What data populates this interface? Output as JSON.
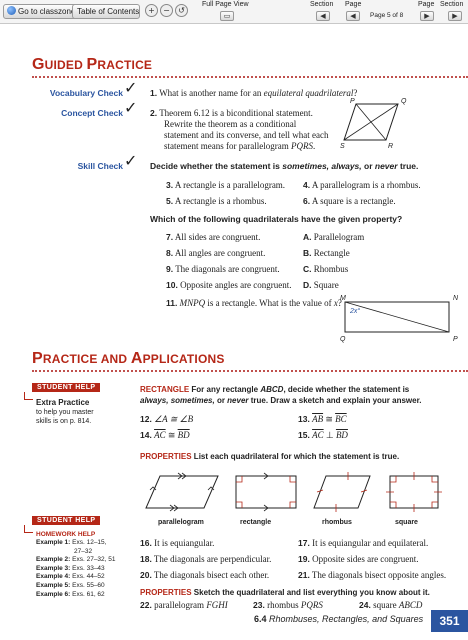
{
  "toolbar": {
    "go_label": "Go to classzone.com",
    "toc_label": "Table of Contents",
    "fullpage_label": "Full Page View",
    "section_label": "Section",
    "page_label": "Page",
    "page_indicator": "Page 5 of 8",
    "page_label2": "Page",
    "section_label2": "Section"
  },
  "guided": {
    "title_first": "G",
    "title_rest": "UIDED ",
    "title_first2": "P",
    "title_rest2": "RACTICE",
    "vocab_label": "Vocabulary Check",
    "concept_label": "Concept Check",
    "skill_label": "Skill Check",
    "check_mark": "✓",
    "q1_num": "1.",
    "q1_text": "What is another name for an ",
    "q1_em": "equilateral quadrilateral",
    "q1_end": "?",
    "q2_num": "2.",
    "q2_l1": "Theorem 6.12 is a biconditional statement.",
    "q2_l2": "Rewrite the theorem as a conditional",
    "q2_l3": "statement and its converse, and tell what each",
    "q2_l4": "statement means for parallelogram ",
    "q2_em": "PQRS",
    "q2_end": ".",
    "fig_P": "P",
    "fig_Q": "Q",
    "fig_S": "S",
    "fig_R": "R",
    "skill_instr_a": "Decide whether the statement is ",
    "skill_instr_b": "sometimes, always,",
    "skill_instr_c": " or ",
    "skill_instr_d": "never",
    "skill_instr_e": " true.",
    "q3_num": "3.",
    "q3": "A rectangle is a parallelogram.",
    "q4_num": "4.",
    "q4": "A parallelogram is a rhombus.",
    "q5_num": "5.",
    "q5": "A rectangle is a rhombus.",
    "q6_num": "6.",
    "q6": "A square is a rectangle.",
    "which": "Which of the following quadrilaterals have the given property?",
    "q7_num": "7.",
    "q7": "All sides are congruent.",
    "q8_num": "8.",
    "q8": "All angles are congruent.",
    "q9_num": "9.",
    "q9": "The diagonals are congruent.",
    "q10_num": "10.",
    "q10": "Opposite angles are congruent.",
    "optA_l": "A.",
    "optA": "Parallelogram",
    "optB_l": "B.",
    "optB": "Rectangle",
    "optC_l": "C.",
    "optC": "Rhombus",
    "optD_l": "D.",
    "optD": "Square",
    "q11_num": "11.",
    "q11_a": "MNPQ",
    "q11_b": " is a rectangle. What is the value of ",
    "q11_c": "x",
    "q11_d": "?",
    "fig_M": "M",
    "fig_N": "N",
    "fig_Q2": "Q",
    "fig_P2": "P",
    "fig_2x": "2x°"
  },
  "practice": {
    "t1": "P",
    "t2": "RACTICE AND ",
    "t3": "A",
    "t4": "PPLICATIONS",
    "student_help": "STUDENT HELP",
    "extra_title": "Extra Practice",
    "extra_l1": "to help you master",
    "extra_l2": "skills is on p. 814.",
    "rect_head": "RECTANGLE",
    "rect_a": " For any rectangle ",
    "rect_b": "ABCD",
    "rect_c": ", decide whether the statement is",
    "rect_d": "always, sometimes,",
    "rect_e": " or ",
    "rect_f": "never",
    "rect_g": " true. Draw a sketch and explain your answer.",
    "q12_num": "12.",
    "q12": "∠A ≅ ∠B",
    "q13_num": "13.",
    "q13a": "AB",
    "q13b": " ≅ ",
    "q13c": "BC",
    "q14_num": "14.",
    "q14a": "AC",
    "q14b": " ≅ ",
    "q14c": "BD",
    "q15_num": "15.",
    "q15a": "AC",
    "q15b": " ⊥ ",
    "q15c": "BD",
    "prop_head": "PROPERTIES",
    "prop_text": " List each quadrilateral for which the statement is true.",
    "lab_para": "parallelogram",
    "lab_rect": "rectangle",
    "lab_rhom": "rhombus",
    "lab_sq": "square",
    "student_help2": "STUDENT HELP",
    "hw_title": "HOMEWORK HELP",
    "ex1_k": "Example 1:",
    "ex1_v": "Exs. 12–15,",
    "ex1_v2": "27–32",
    "ex2_k": "Example 2:",
    "ex2_v": "Exs. 27–32, 51",
    "ex3_k": "Example 3:",
    "ex3_v": "Exs. 33–43",
    "ex4_k": "Example 4:",
    "ex4_v": "Exs. 44–52",
    "ex5_k": "Example 5:",
    "ex5_v": "Exs. 55–60",
    "ex6_k": "Example 6:",
    "ex6_v": "Exs. 61, 62",
    "q16_num": "16.",
    "q16": "It is equiangular.",
    "q17_num": "17.",
    "q17": "It is equiangular and equilateral.",
    "q18_num": "18.",
    "q18": "The diagonals are perpendicular.",
    "q19_num": "19.",
    "q19": "Opposite sides are congruent.",
    "q20_num": "20.",
    "q20": "The diagonals bisect each other.",
    "q21_num": "21.",
    "q21": "The diagonals bisect opposite angles.",
    "prop2_head": "PROPERTIES",
    "prop2_text": " Sketch the quadrilateral and list everything you know about it.",
    "q22_num": "22.",
    "q22a": "parallelogram ",
    "q22b": "FGHI",
    "q23_num": "23.",
    "q23a": "rhombus ",
    "q23b": "PQRS",
    "q24_num": "24.",
    "q24a": "square ",
    "q24b": "ABCD"
  },
  "footer": {
    "section_num": "6.4",
    "section_title": "Rhombuses, Rectangles, and Squares",
    "page_number": "351"
  },
  "colors": {
    "accent_red": "#b52717",
    "accent_blue": "#2b55a0"
  }
}
